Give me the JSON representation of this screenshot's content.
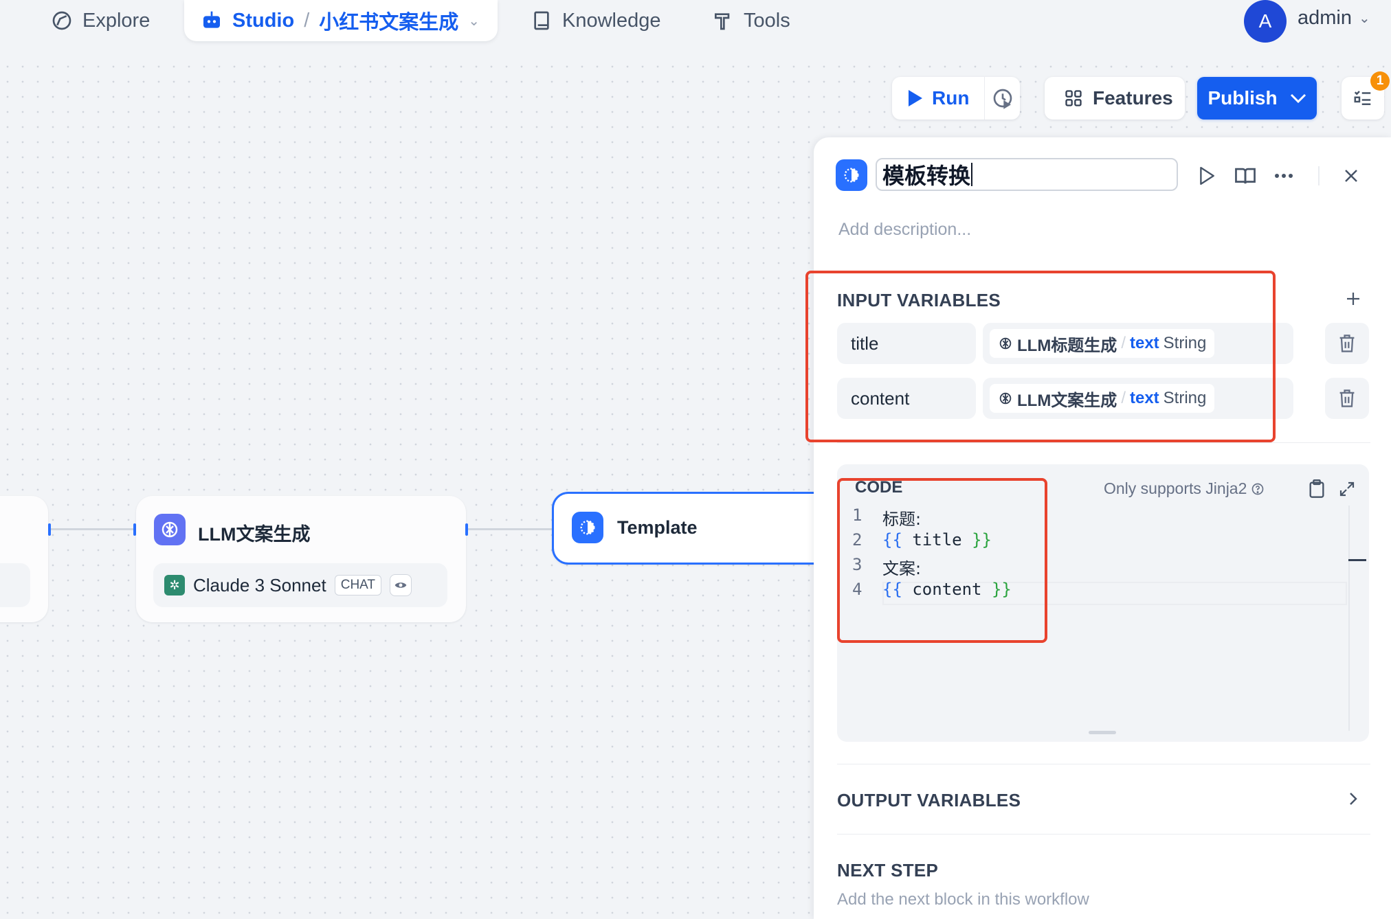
{
  "nav": {
    "explore": "Explore",
    "studio": "Studio",
    "separator": "/",
    "app_name": "小红书文案生成",
    "knowledge": "Knowledge",
    "tools": "Tools",
    "avatar_initial": "A",
    "username": "admin"
  },
  "toolbar": {
    "run": "Run",
    "features": "Features",
    "publish": "Publish",
    "checklist_count": "1"
  },
  "canvas": {
    "nodes": [
      {
        "title": "LLM文案生成",
        "model": "Claude 3 Sonnet",
        "mode_tag": "CHAT"
      },
      {
        "title": "Template"
      }
    ]
  },
  "panel": {
    "title": "模板转换",
    "description_placeholder": "Add description...",
    "input_variables_label": "INPUT VARIABLES",
    "variables": [
      {
        "name": "title",
        "source_node": "LLM标题生成",
        "var": "text",
        "type": "String"
      },
      {
        "name": "content",
        "source_node": "LLM文案生成",
        "var": "text",
        "type": "String"
      }
    ],
    "code": {
      "label": "CODE",
      "note": "Only supports Jinja2",
      "lines": [
        {
          "num": "1",
          "text": "标题:"
        },
        {
          "num": "2",
          "open": "{{",
          "var": " title ",
          "close": "}}"
        },
        {
          "num": "3",
          "text": "文案:"
        },
        {
          "num": "4",
          "open": "{{",
          "var": " content ",
          "close": "}}"
        }
      ]
    },
    "output_variables_label": "OUTPUT VARIABLES",
    "next_step_label": "NEXT STEP",
    "next_step_desc": "Add the next block in this workflow"
  },
  "colors": {
    "accent": "#155eef",
    "highlight_box": "#e8432e",
    "badge": "#f79009"
  }
}
